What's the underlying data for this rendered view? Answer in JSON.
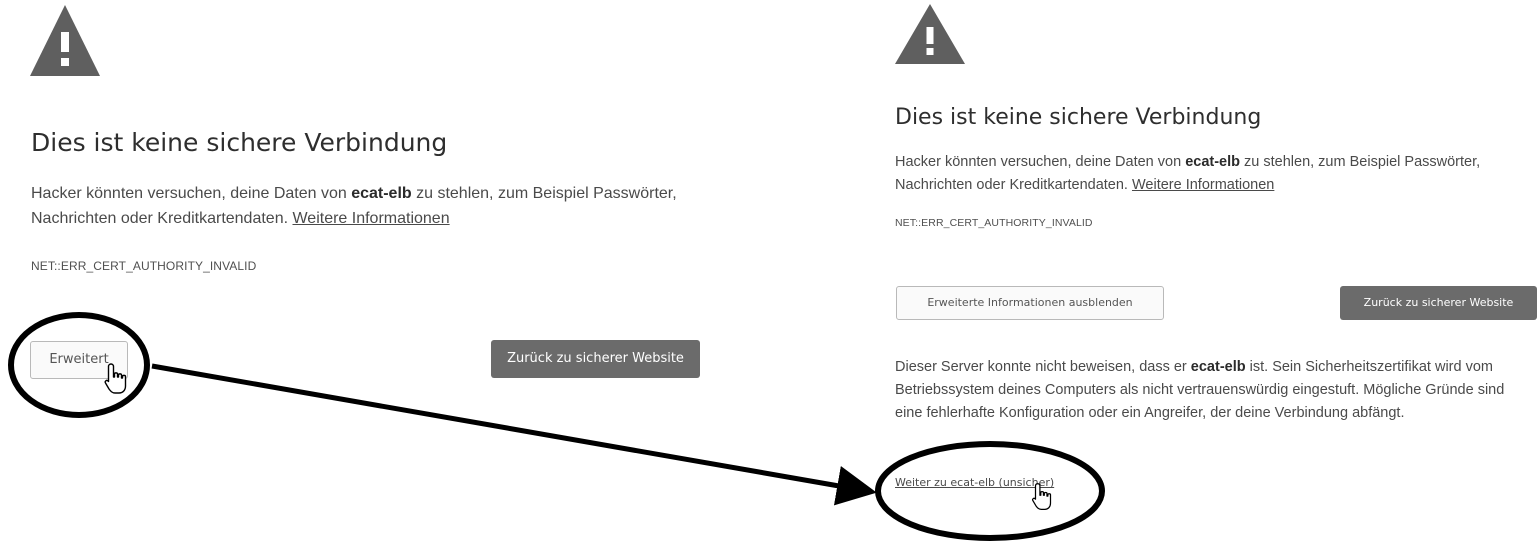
{
  "left_panel": {
    "title": "Dies ist keine sichere Verbindung",
    "body_before": "Hacker könnten versuchen, deine Daten von ",
    "host": "ecat-elb",
    "body_after": " zu stehlen, zum Beispiel Passwörter, Nachrichten oder Kreditkartendaten. ",
    "more_info_link": "Weitere Informationen",
    "error_code": "NET::ERR_CERT_AUTHORITY_INVALID",
    "advanced_button": "Erweitert",
    "back_button": "Zurück zu sicherer Website"
  },
  "right_panel": {
    "title": "Dies ist keine sichere Verbindung",
    "body_before": "Hacker könnten versuchen, deine Daten von ",
    "host": "ecat-elb",
    "body_after": " zu stehlen, zum Beispiel Passwörter, Nachrichten oder Kreditkartendaten. ",
    "more_info_link": "Weitere Informationen",
    "error_code": "NET::ERR_CERT_AUTHORITY_INVALID",
    "hide_advanced_button": "Erweiterte Informationen ausblenden",
    "back_button": "Zurück zu sicherer Website",
    "details_before": "Dieser Server konnte nicht beweisen, dass er ",
    "details_host": "ecat-elb",
    "details_after": " ist. Sein Sicherheitszertifikat wird vom Betriebssystem deines Computers als nicht vertrauenswürdig eingestuft. Mögliche Gründe sind eine fehlerhafte Konfiguration oder ein Angreifer, der deine Verbindung abfängt.",
    "proceed_link": "Weiter zu ecat-elb (unsicher)"
  },
  "colors": {
    "warning_icon": "#5f5f5f",
    "dark_button": "#6b6b6b",
    "annotation": "#000000"
  },
  "icons": [
    "warning-triangle-icon",
    "hand-pointer-icon",
    "annotation-arrow"
  ]
}
